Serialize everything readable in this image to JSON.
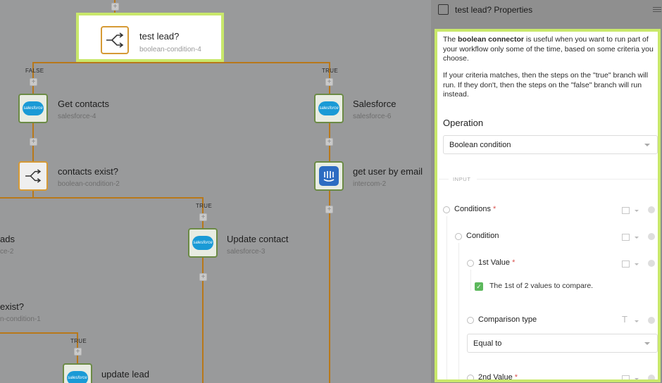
{
  "canvas": {
    "selected": {
      "title": "test lead?",
      "id": "boolean-condition-4"
    },
    "branch_false": "FALSE",
    "branch_true": "TRUE",
    "nodes": {
      "get_contacts": {
        "title": "Get contacts",
        "id": "salesforce-4"
      },
      "contacts_exist": {
        "title": "contacts exist?",
        "id": "boolean-condition-2"
      },
      "salesforce": {
        "title": "Salesforce",
        "id": "salesforce-6"
      },
      "get_user": {
        "title": "get user by email",
        "id": "intercom-2"
      },
      "update_contact": {
        "title": "Update contact",
        "id": "salesforce-3"
      },
      "leads_partial": {
        "title": "ads",
        "id": "ce-2"
      },
      "exist_partial": {
        "title": "exist?",
        "id": "n-condition-1"
      },
      "update_lead": {
        "title": "update lead"
      }
    },
    "plus_symbol": "+",
    "salesforce_logo_text": "salesforce"
  },
  "panel": {
    "title": "test lead? Properties",
    "description_bold": "boolean connector",
    "description_pre": "The ",
    "description_post": " is useful when you want to run part of your workflow only some of the time, based on some criteria you choose.",
    "description2": "If your criteria matches, then the steps on the \"true\" branch will run. If they don't, then the steps on the \"false\" branch will run instead.",
    "operation_label": "Operation",
    "operation_value": "Boolean condition",
    "input_label": "INPUT",
    "conditions_label": "Conditions",
    "condition_label": "Condition",
    "first_value_label": "1st Value",
    "first_value_check": "The 1st of 2 values to compare.",
    "comparison_label": "Comparison type",
    "comparison_value": "Equal to",
    "second_value_label": "2nd Value",
    "required_mark": "*"
  },
  "colors": {
    "highlight": "#c9e86b",
    "wire": "#b8781a",
    "salesforce": "#1a9ad6",
    "intercom": "#2d6cc2",
    "check": "#5cb85c"
  }
}
